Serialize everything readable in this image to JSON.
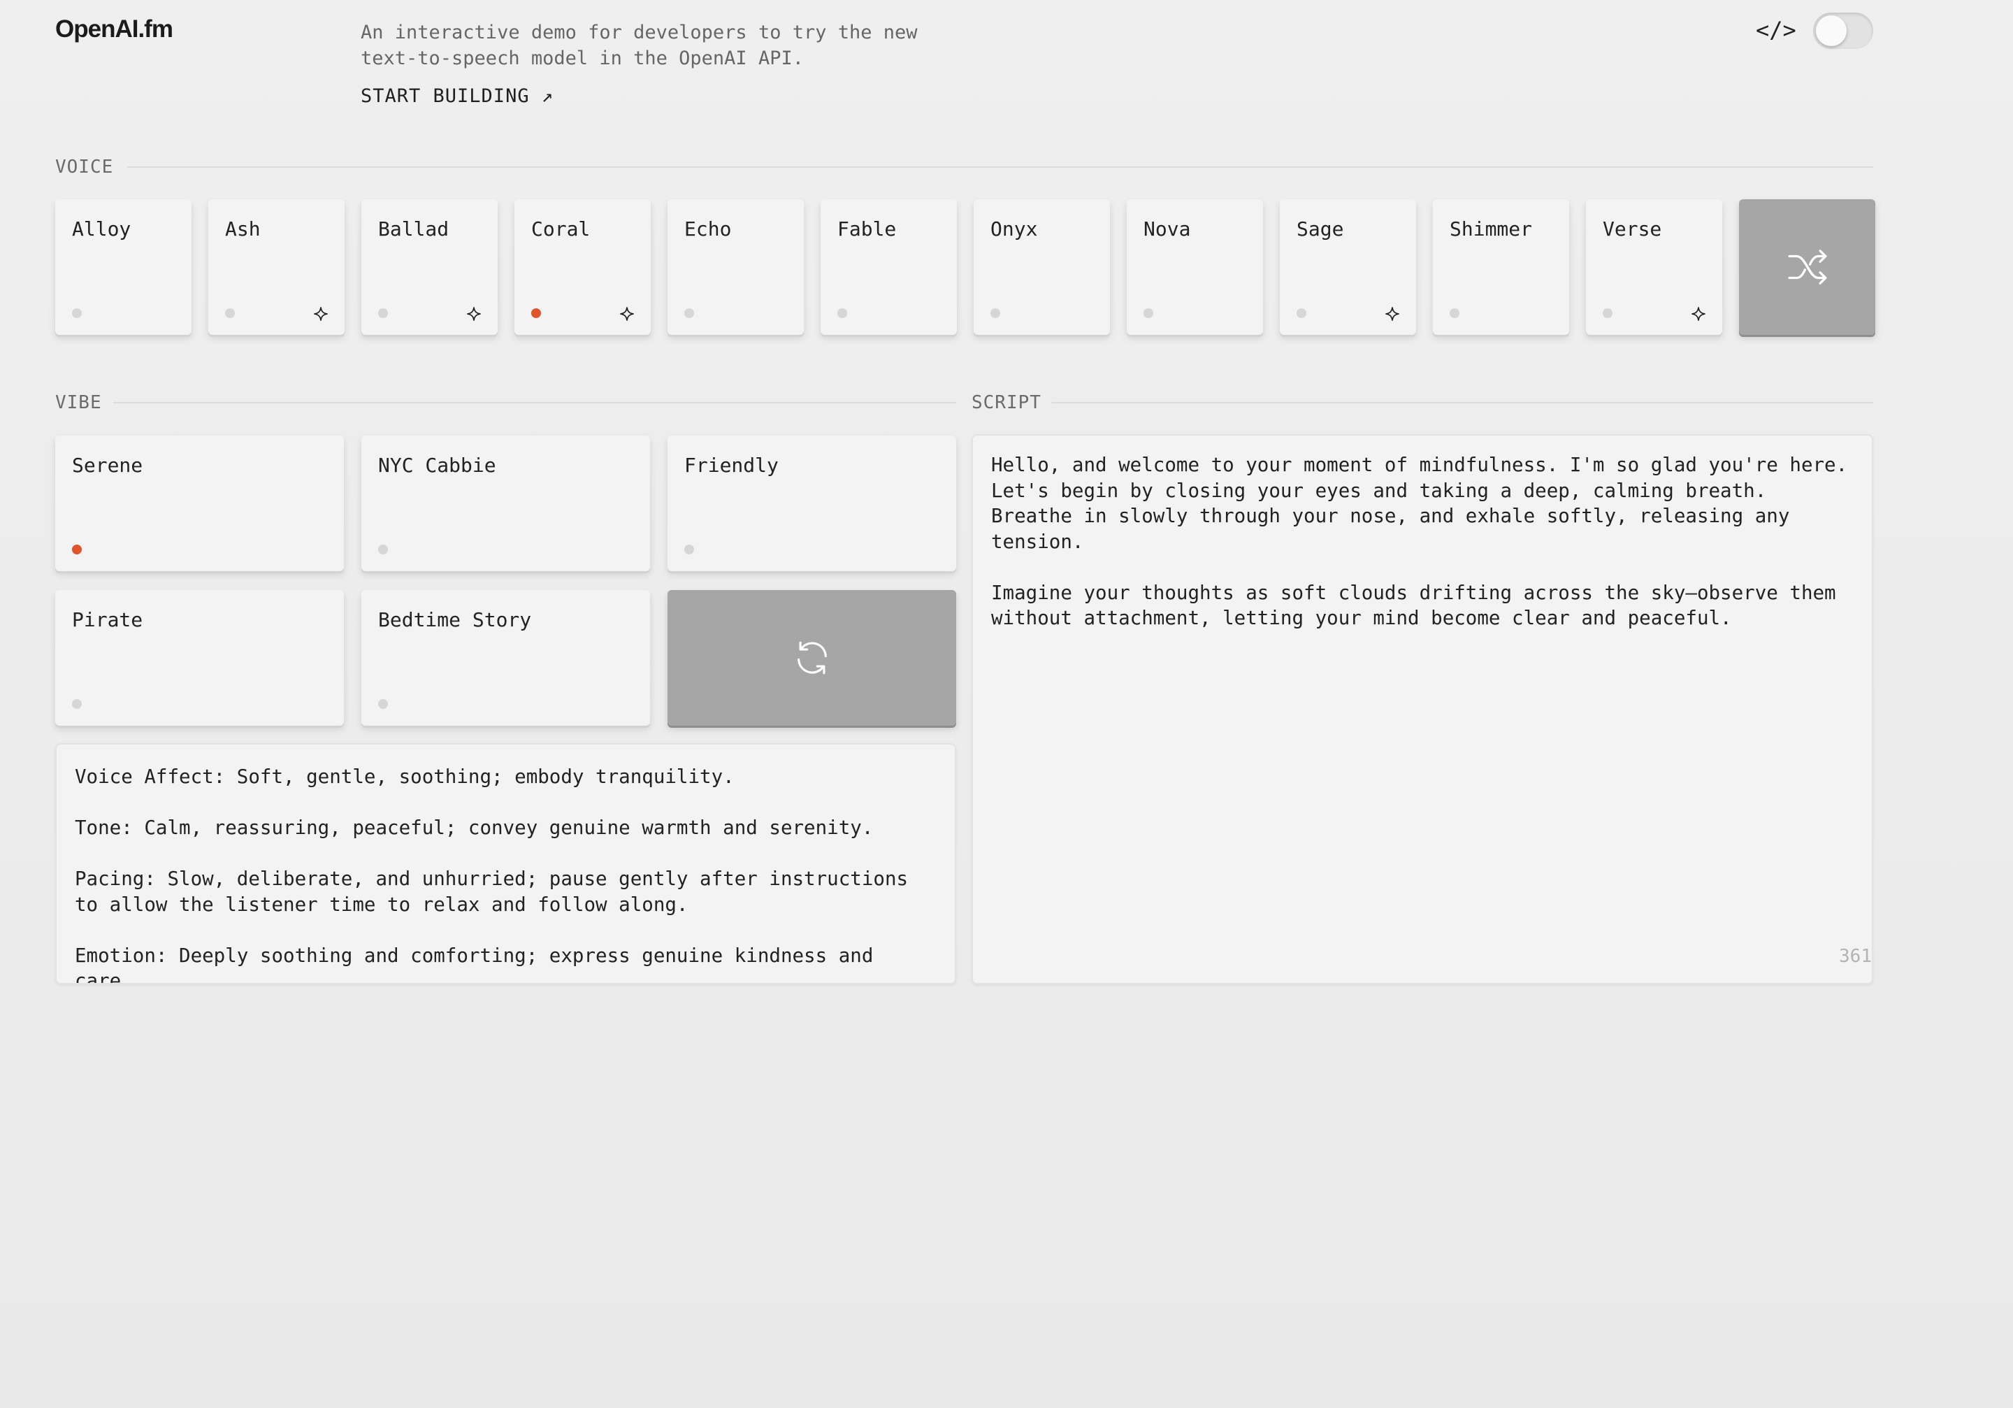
{
  "header": {
    "logo": "OpenAI.fm",
    "tagline": "An interactive demo for developers to try the new text-to-speech model in the OpenAI API.",
    "cta": "START BUILDING ↗",
    "code_toggle": "</>",
    "theme_switch_on": false
  },
  "voice": {
    "label": "VOICE",
    "items": [
      {
        "name": "Alloy",
        "selected": false,
        "sparkle": false
      },
      {
        "name": "Ash",
        "selected": false,
        "sparkle": true
      },
      {
        "name": "Ballad",
        "selected": false,
        "sparkle": true
      },
      {
        "name": "Coral",
        "selected": true,
        "sparkle": true
      },
      {
        "name": "Echo",
        "selected": false,
        "sparkle": false
      },
      {
        "name": "Fable",
        "selected": false,
        "sparkle": false
      },
      {
        "name": "Onyx",
        "selected": false,
        "sparkle": false
      },
      {
        "name": "Nova",
        "selected": false,
        "sparkle": false
      },
      {
        "name": "Sage",
        "selected": false,
        "sparkle": true
      },
      {
        "name": "Shimmer",
        "selected": false,
        "sparkle": false
      },
      {
        "name": "Verse",
        "selected": false,
        "sparkle": true
      }
    ],
    "shuffle_icon": "shuffle-icon"
  },
  "vibe": {
    "label": "VIBE",
    "items": [
      {
        "name": "Serene",
        "selected": true
      },
      {
        "name": "NYC Cabbie",
        "selected": false
      },
      {
        "name": "Friendly",
        "selected": false
      },
      {
        "name": "Pirate",
        "selected": false
      },
      {
        "name": "Bedtime Story",
        "selected": false
      }
    ],
    "refresh_icon": "refresh-icon",
    "description": "Voice Affect: Soft, gentle, soothing; embody tranquility.\n\nTone: Calm, reassuring, peaceful; convey genuine warmth and serenity.\n\nPacing: Slow, deliberate, and unhurried; pause gently after instructions to allow the listener time to relax and follow along.\n\nEmotion: Deeply soothing and comforting; express genuine kindness and care."
  },
  "script": {
    "label": "SCRIPT",
    "text": "Hello, and welcome to your moment of mindfulness. I'm so glad you're here. Let's begin by closing your eyes and taking a deep, calming breath. Breathe in slowly through your nose, and exhale softly, releasing any tension.\n\nImagine your thoughts as soft clouds drifting across the sky—observe them without attachment, letting your mind become clear and peaceful.",
    "char_count": "361"
  },
  "colors": {
    "accent": "#e1532a",
    "tile_bg": "#f3f3f3",
    "dark_tile_bg": "#a6a6a6",
    "page_bg": "#ececec"
  }
}
